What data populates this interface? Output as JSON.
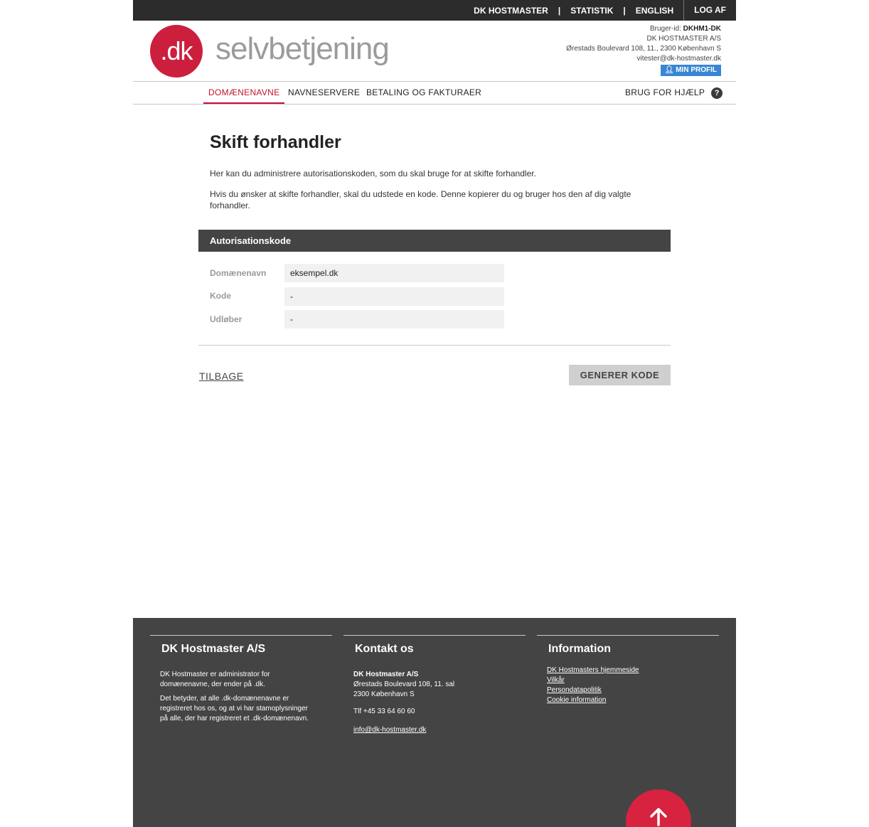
{
  "topnav": {
    "items": [
      "DK HOSTMASTER",
      "STATISTIK",
      "ENGLISH"
    ],
    "separator": "|",
    "logout": "LOG AF"
  },
  "logo": {
    "mark": ".dk",
    "text": "selvbetjening"
  },
  "user": {
    "id_label": "Bruger-id:",
    "id_value": "DKHM1-DK",
    "company": "DK HOSTMASTER A/S",
    "address": "Ørestads Boulevard 108, 11., 2300 København S",
    "email": "vitester@dk-hostmaster.dk",
    "profile_button": "MIN PROFIL"
  },
  "mainnav": {
    "items": [
      "DOMÆNENAVNE",
      "NAVNESERVERE",
      "BETALING OG FAKTURAER"
    ],
    "active_index": 0,
    "help": "BRUG FOR HJÆLP",
    "help_icon": "?"
  },
  "page": {
    "title": "Skift forhandler",
    "intro1": "Her kan du administrere autorisationskoden, som du skal bruge for at skifte forhandler.",
    "intro2": "Hvis du ønsker at skifte forhandler, skal du udstede en kode. Denne kopierer du og bruger hos den af dig valgte forhandler."
  },
  "auth": {
    "header": "Autorisationskode",
    "rows": [
      {
        "label": "Domænenavn",
        "value": "eksempel.dk"
      },
      {
        "label": "Kode",
        "value": "-"
      },
      {
        "label": "Udløber",
        "value": "-"
      }
    ]
  },
  "actions": {
    "back": "TILBAGE",
    "generate": "GENERER KODE"
  },
  "footer": {
    "col1": {
      "title": "DK Hostmaster A/S",
      "p1": "DK Hostmaster er administrator for domænenavne, der ender på .dk.",
      "p2": "Det betyder, at alle .dk-domænenavne er registreret hos os, og at vi har stamoplysninger på alle, der har registreret et .dk-domænenavn."
    },
    "col2": {
      "title": "Kontakt os",
      "company": "DK Hostmaster A/S",
      "address1": "Ørestads Boulevard 108, 11. sal",
      "address2": "2300 København S",
      "phone": "Tlf +45 33 64 60 60",
      "email": "info@dk-hostmaster.dk"
    },
    "col3": {
      "title": "Information",
      "links": [
        "DK Hostmasters hjemmeside",
        "Vilkår",
        "Persondatapolitik",
        "Cookie information"
      ]
    }
  },
  "scroll_top_icon": "arrow-up-icon",
  "colors": {
    "brand_red": "#cc1f3d",
    "profile_blue": "#3a86d4",
    "dark_bar": "#2c2c2c",
    "footer_bg": "#444444"
  }
}
